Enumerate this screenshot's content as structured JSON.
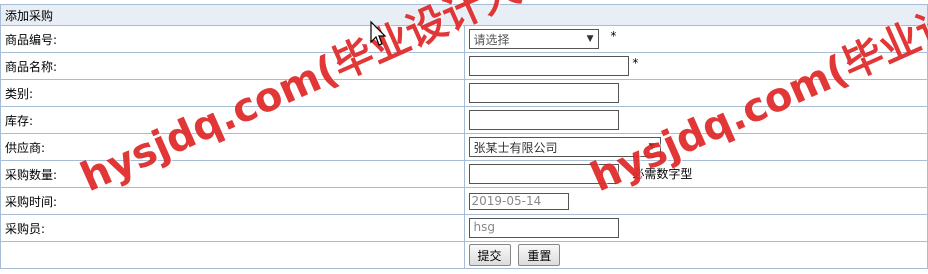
{
  "form": {
    "title": "添加采购",
    "rows": {
      "product_code": {
        "label": "商品编号:",
        "placeholder": "请选择",
        "required": "*"
      },
      "product_name": {
        "label": "商品名称:",
        "value": "",
        "required": "*"
      },
      "category": {
        "label": "类别:",
        "value": ""
      },
      "stock": {
        "label": "库存:",
        "value": ""
      },
      "supplier": {
        "label": "供应商:",
        "selected": "张某士有限公司"
      },
      "quantity": {
        "label": "采购数量:",
        "value": "",
        "hint": "必需数字型"
      },
      "purchase_time": {
        "label": "采购时间:",
        "value": "2019-05-14"
      },
      "purchaser": {
        "label": "采购员:",
        "value": "hsg"
      }
    },
    "buttons": {
      "submit": "提交",
      "reset": "重置"
    }
  },
  "watermark": {
    "left": "hysjdq.com(毕业设计大全)",
    "right": "hysjdq.com(毕业设计大"
  }
}
